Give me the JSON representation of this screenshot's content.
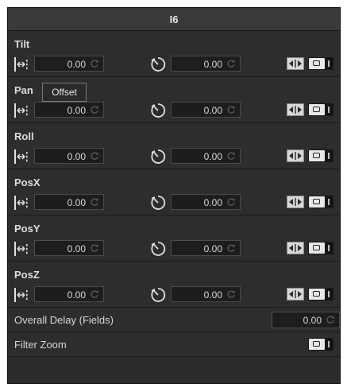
{
  "panel": {
    "title": "I6"
  },
  "tooltip": {
    "text": "Offset"
  },
  "sections": [
    {
      "label": "Tilt",
      "offset_value": "0.00",
      "delay_value": "0.00"
    },
    {
      "label": "Pan",
      "offset_value": "0.00",
      "delay_value": "0.00"
    },
    {
      "label": "Roll",
      "offset_value": "0.00",
      "delay_value": "0.00"
    },
    {
      "label": "PosX",
      "offset_value": "0.00",
      "delay_value": "0.00"
    },
    {
      "label": "PosY",
      "offset_value": "0.00",
      "delay_value": "0.00"
    },
    {
      "label": "PosZ",
      "offset_value": "0.00",
      "delay_value": "0.00"
    }
  ],
  "overall_delay": {
    "label": "Overall Delay (Fields)",
    "value": "0.00"
  },
  "filter_zoom": {
    "label": "Filter Zoom"
  },
  "icons": {
    "range": "range-arrows-icon",
    "timer": "timer-icon",
    "spin": "refresh-spin-icon",
    "swap": "swap-arrows-icon",
    "toggle": "toggle-switch"
  },
  "colors": {
    "panel_bg": "#2d2d2d",
    "field_bg": "#1d1d1d",
    "text": "#dedede"
  }
}
